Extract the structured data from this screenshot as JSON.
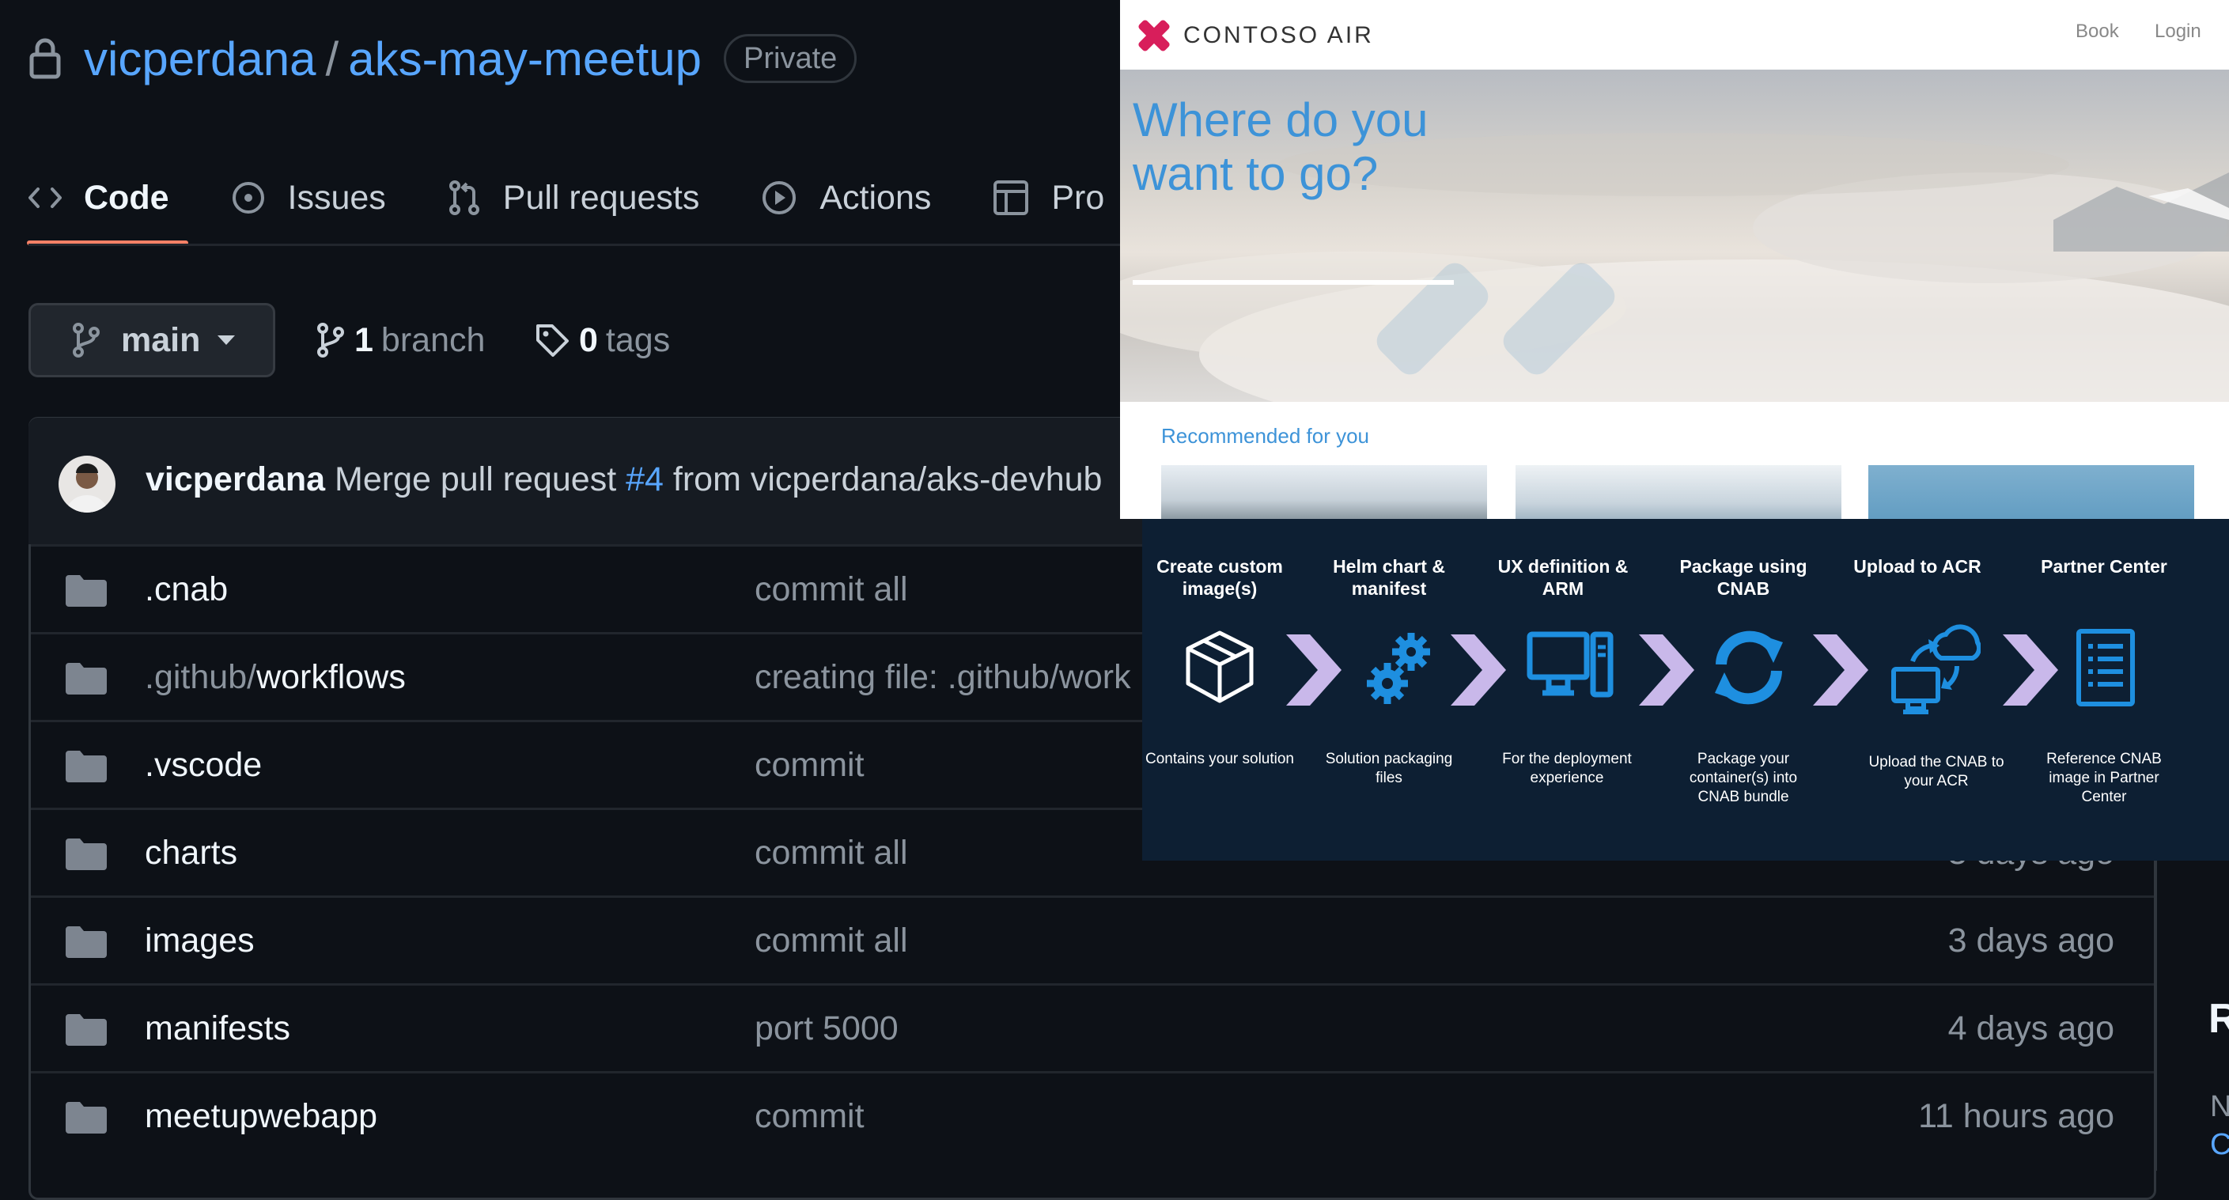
{
  "github": {
    "repo": {
      "owner": "vicperdana",
      "separator": "/",
      "name": "aks-may-meetup",
      "visibility": "Private"
    },
    "tabs": [
      {
        "label": "Code",
        "icon": "code-icon",
        "active": true
      },
      {
        "label": "Issues",
        "icon": "issue-opened-icon"
      },
      {
        "label": "Pull requests",
        "icon": "git-pull-request-icon"
      },
      {
        "label": "Actions",
        "icon": "play-icon"
      },
      {
        "label": "Pro",
        "icon": "table-icon"
      }
    ],
    "branch_selector": {
      "label": "main"
    },
    "branches": {
      "count": "1",
      "label": "branch"
    },
    "tags": {
      "count": "0",
      "label": "tags"
    },
    "latest_commit": {
      "author": "vicperdana",
      "message_prefix": "Merge pull request",
      "pr": "#4",
      "message_suffix": "from vicperdana/aks-devhub"
    },
    "files": [
      {
        "name": ".cnab",
        "prefix": "",
        "message": "commit all",
        "age": ""
      },
      {
        "name": "workflows",
        "prefix": ".github/",
        "message": "creating file: .github/work",
        "age": ""
      },
      {
        "name": ".vscode",
        "prefix": "",
        "message": "commit",
        "age": ""
      },
      {
        "name": "charts",
        "prefix": "",
        "message": "commit all",
        "age": "3 days ago"
      },
      {
        "name": "images",
        "prefix": "",
        "message": "commit all",
        "age": "3 days ago"
      },
      {
        "name": "manifests",
        "prefix": "",
        "message": "port 5000",
        "age": "4 days ago"
      },
      {
        "name": "meetupwebapp",
        "prefix": "",
        "message": "commit",
        "age": "11 hours ago"
      }
    ],
    "sidebar": {
      "heading": "R",
      "text1": "N",
      "text2": "C"
    }
  },
  "contoso": {
    "brand": "CONTOSO AIR",
    "nav": {
      "book": "Book",
      "login": "Login"
    },
    "hero_title": "Where do you want to go?",
    "recommended": "Recommended for you"
  },
  "cnab_steps": [
    {
      "title": "Create custom image(s)",
      "desc": "Contains your solution",
      "icon": "box-icon"
    },
    {
      "title": "Helm chart & manifest",
      "desc": "Solution packaging files",
      "icon": "gears-icon"
    },
    {
      "title": "UX definition & ARM",
      "desc": "For the deployment experience",
      "icon": "desktop-icon"
    },
    {
      "title": "Package using CNAB",
      "desc": "Package your container(s) into CNAB bundle",
      "icon": "sync-icon"
    },
    {
      "title": "Upload to ACR",
      "desc": "Upload the CNAB to your ACR",
      "icon": "cloud-upload-icon"
    },
    {
      "title": "Partner Center",
      "desc": "Reference CNAB image in Partner Center",
      "icon": "document-list-icon"
    }
  ],
  "colors": {
    "github_bg": "#0d1117",
    "link": "#58a6ff",
    "tab_underline": "#f78166",
    "contoso_blue": "#3d93d8",
    "chevron": "#c9b8ea",
    "icon_blue": "#1e8fe0"
  }
}
